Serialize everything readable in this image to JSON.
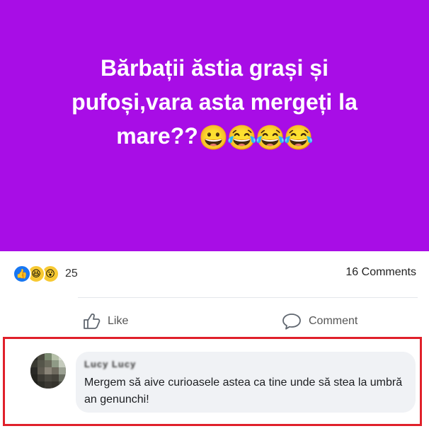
{
  "post": {
    "text_line1": "Bărbații ăstia grași și",
    "text_line2": "pufoși,vara asta mergeți la",
    "text_line3": "mare??",
    "emojis": [
      "😀",
      "😂",
      "😂",
      "😂"
    ],
    "background_color": "#a80de6"
  },
  "stats": {
    "reactions": [
      {
        "name": "like",
        "glyph": "👍"
      },
      {
        "name": "haha",
        "glyph": "😆"
      },
      {
        "name": "wow",
        "glyph": "😮"
      }
    ],
    "reaction_count": "25",
    "comments_count": "16 Comments"
  },
  "actions": {
    "like_label": "Like",
    "comment_label": "Comment"
  },
  "comment": {
    "author": "Lucy Lucy",
    "text": "Mergem să aive curioasele astea ca tine unde să stea la umbră an genunchi!",
    "highlight_color": "#e0202a"
  }
}
